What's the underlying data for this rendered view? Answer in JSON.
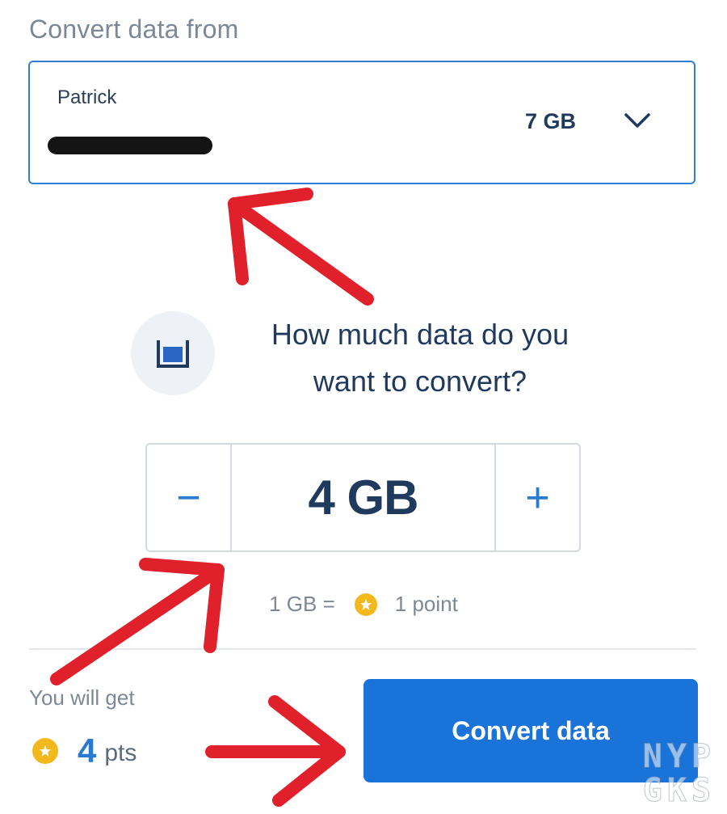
{
  "convert_from": {
    "label": "Convert data from",
    "account_name": "Patrick",
    "balance": "7 GB"
  },
  "question": {
    "line1": "How much data do you",
    "line2": "want to convert?"
  },
  "stepper": {
    "minus": "−",
    "value": "4 GB",
    "plus": "+"
  },
  "rate": {
    "left": "1 GB =",
    "right": "1 point"
  },
  "summary": {
    "label": "You will get",
    "points": "4",
    "unit": "pts"
  },
  "convert_button": "Convert data",
  "watermark": {
    "line1": "NYP",
    "line2": "GKS"
  },
  "colors": {
    "accent": "#1a73d9",
    "text_dark": "#1f3a5c",
    "text_muted": "#7d8896",
    "coin": "#f2b81c",
    "annotation": "#e0202a"
  },
  "icons": {
    "dropdown": "chevron-down-icon",
    "question": "data-bucket-icon",
    "coin": "star-coin-icon"
  }
}
